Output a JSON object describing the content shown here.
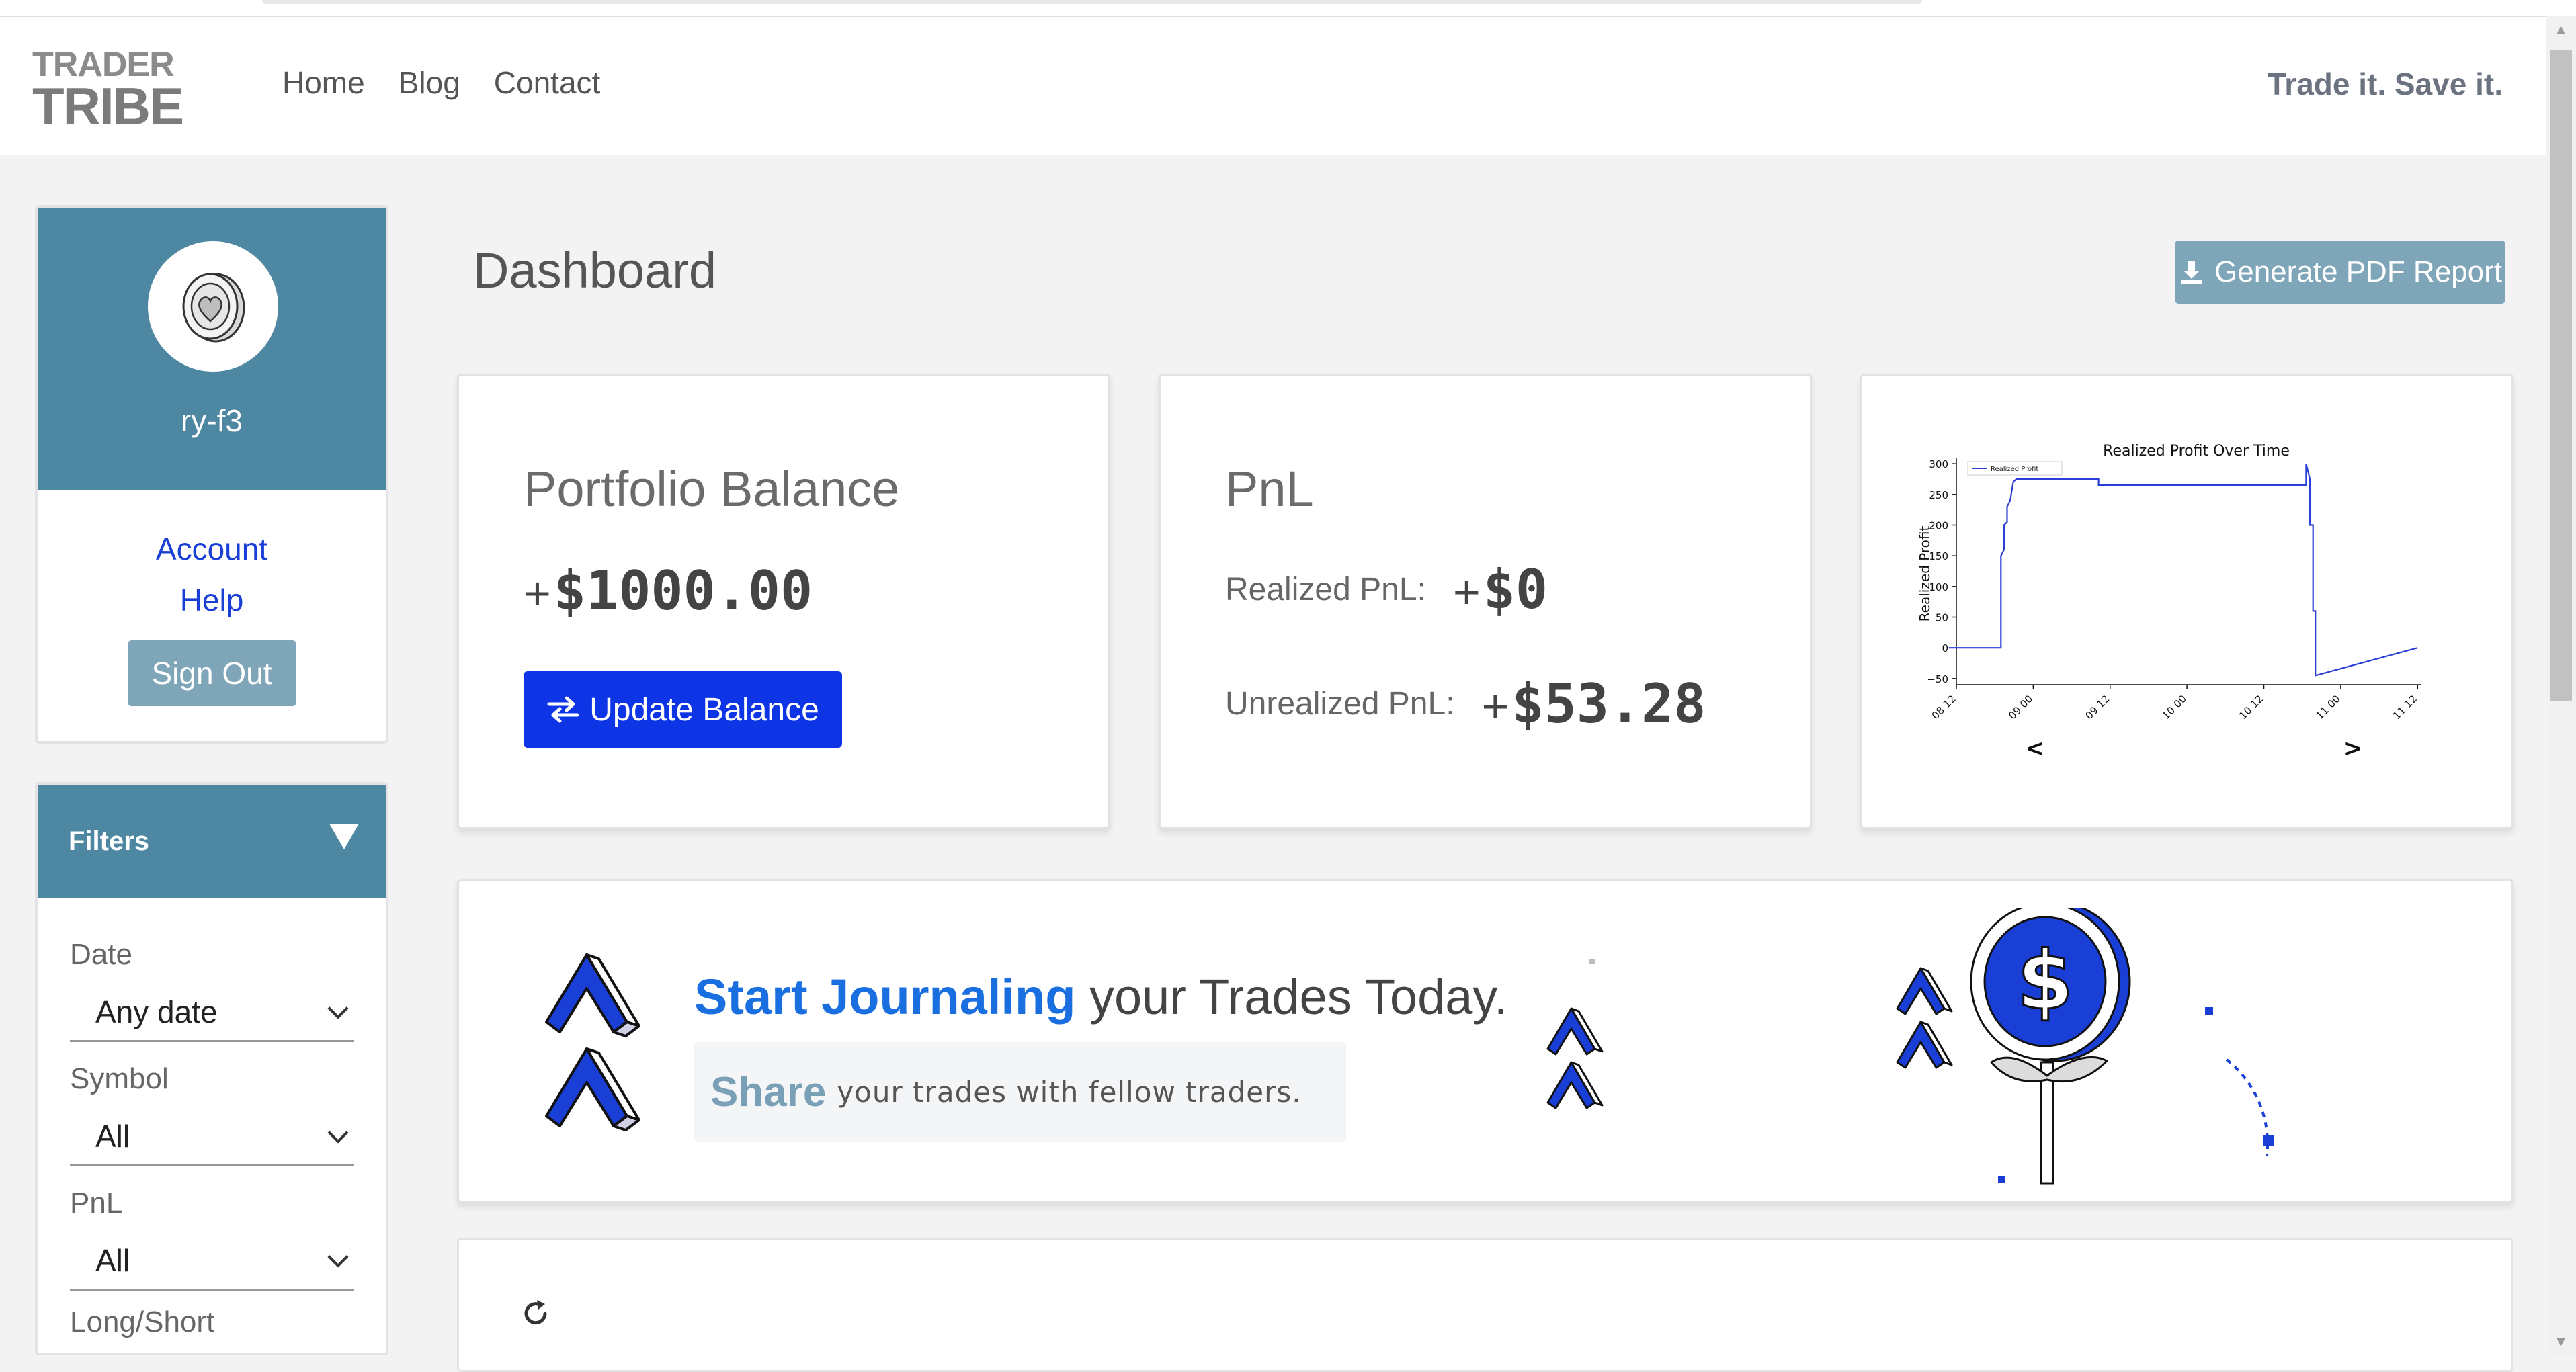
{
  "app": {
    "logo_line1": "TRADER",
    "logo_line2": "TRIBE",
    "tagline": "Trade it. Save it."
  },
  "nav": {
    "items": [
      {
        "label": "Home"
      },
      {
        "label": "Blog"
      },
      {
        "label": "Contact"
      }
    ]
  },
  "profile": {
    "username": "ry-f3",
    "links": [
      {
        "label": "Account"
      },
      {
        "label": "Help"
      }
    ],
    "signout_label": "Sign Out"
  },
  "filters": {
    "title": "Filters",
    "groups": [
      {
        "label": "Date",
        "value": "Any date"
      },
      {
        "label": "Symbol",
        "value": "All"
      },
      {
        "label": "PnL",
        "value": "All"
      }
    ],
    "partial_label": "Long/Short"
  },
  "dashboard": {
    "title": "Dashboard",
    "pdf_button": "Generate PDF Report"
  },
  "portfolio": {
    "title": "Portfolio Balance",
    "sign": "+",
    "balance": "$1000.00",
    "update_button": "Update Balance"
  },
  "pnl": {
    "title": "PnL",
    "realized_label": "Realized PnL:",
    "realized_sign": "+",
    "realized_value": "$0",
    "unrealized_label": "Unrealized PnL:",
    "unrealized_sign": "+",
    "unrealized_value": "$53.28"
  },
  "chart_nav": {
    "prev": "<",
    "next": ">"
  },
  "chart_data": {
    "type": "line",
    "title": "Realized Profit Over Time",
    "ylabel": "Realized Profit",
    "xlabel": "",
    "legend": "Realized Profit",
    "legend_position": "top-left",
    "ylim": [
      -60,
      310
    ],
    "yticks": [
      300,
      250,
      200,
      150,
      100,
      50,
      0,
      -50
    ],
    "xticks": [
      "08 12",
      "09 00",
      "09 12",
      "10 00",
      "10 12",
      "11 00",
      "11 12"
    ],
    "xlim": [
      0,
      6.05
    ],
    "line_color": "#2b3fd6",
    "series": [
      {
        "name": "Realized Profit",
        "x": [
          -0.1,
          0.58,
          0.58,
          0.62,
          0.62,
          0.66,
          0.66,
          0.7,
          0.7,
          0.74,
          0.74,
          0.78,
          0.78,
          1.85,
          1.85,
          4.55,
          4.55,
          4.6,
          4.6,
          4.64,
          4.64,
          4.67,
          4.67,
          6.0
        ],
        "y": [
          0,
          0,
          150,
          160,
          200,
          205,
          230,
          240,
          240,
          270,
          270,
          275,
          275,
          275,
          265,
          265,
          300,
          275,
          200,
          200,
          60,
          60,
          -45,
          0
        ]
      }
    ]
  },
  "banner": {
    "accent": "Start Journaling",
    "rest": " your Trades Today.",
    "sub_accent": "Share",
    "sub_rest": "your trades with fellow traders."
  }
}
